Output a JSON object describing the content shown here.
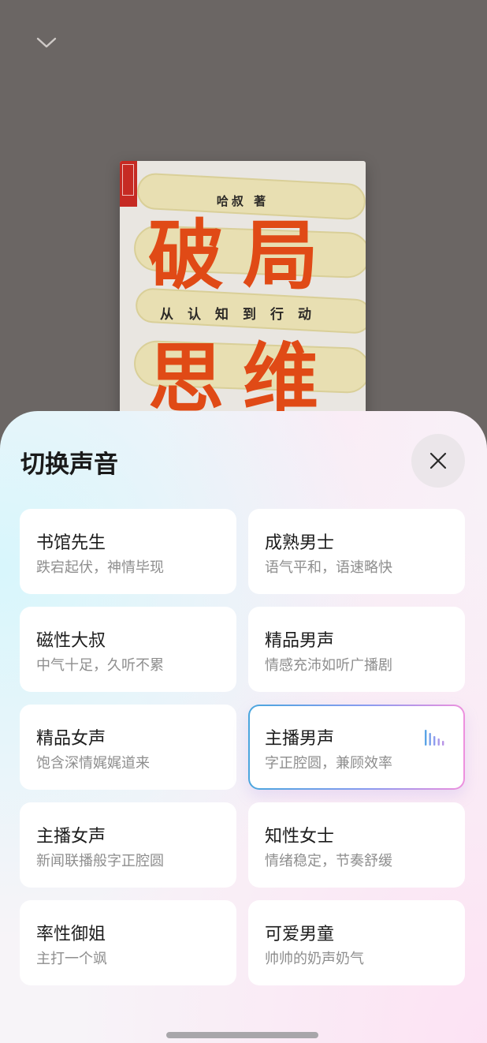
{
  "book": {
    "author": "哈叔 著",
    "title_line1": "破局",
    "subtitle": "从认知到行动",
    "title_line2": "思维"
  },
  "sheet": {
    "title": "切换声音",
    "voices": [
      {
        "name": "书馆先生",
        "desc": "跌宕起伏，神情毕现",
        "selected": false
      },
      {
        "name": "成熟男士",
        "desc": "语气平和，语速略快",
        "selected": false
      },
      {
        "name": "磁性大叔",
        "desc": "中气十足，久听不累",
        "selected": false
      },
      {
        "name": "精品男声",
        "desc": "情感充沛如听广播剧",
        "selected": false
      },
      {
        "name": "精品女声",
        "desc": "饱含深情娓娓道来",
        "selected": false
      },
      {
        "name": "主播男声",
        "desc": "字正腔圆，兼顾效率",
        "selected": true
      },
      {
        "name": "主播女声",
        "desc": "新闻联播般字正腔圆",
        "selected": false
      },
      {
        "name": "知性女士",
        "desc": "情绪稳定，节奏舒缓",
        "selected": false
      },
      {
        "name": "率性御姐",
        "desc": "主打一个飒",
        "selected": false
      },
      {
        "name": "可爱男童",
        "desc": "帅帅的奶声奶气",
        "selected": false
      }
    ]
  },
  "icons": {
    "collapse": "chevron-down-icon",
    "close": "close-icon",
    "playing": "audio-bars-icon"
  },
  "colors": {
    "accent_blue": "#4aa6de",
    "accent_pink": "#ee90de",
    "title_orange": "#e04a16"
  }
}
